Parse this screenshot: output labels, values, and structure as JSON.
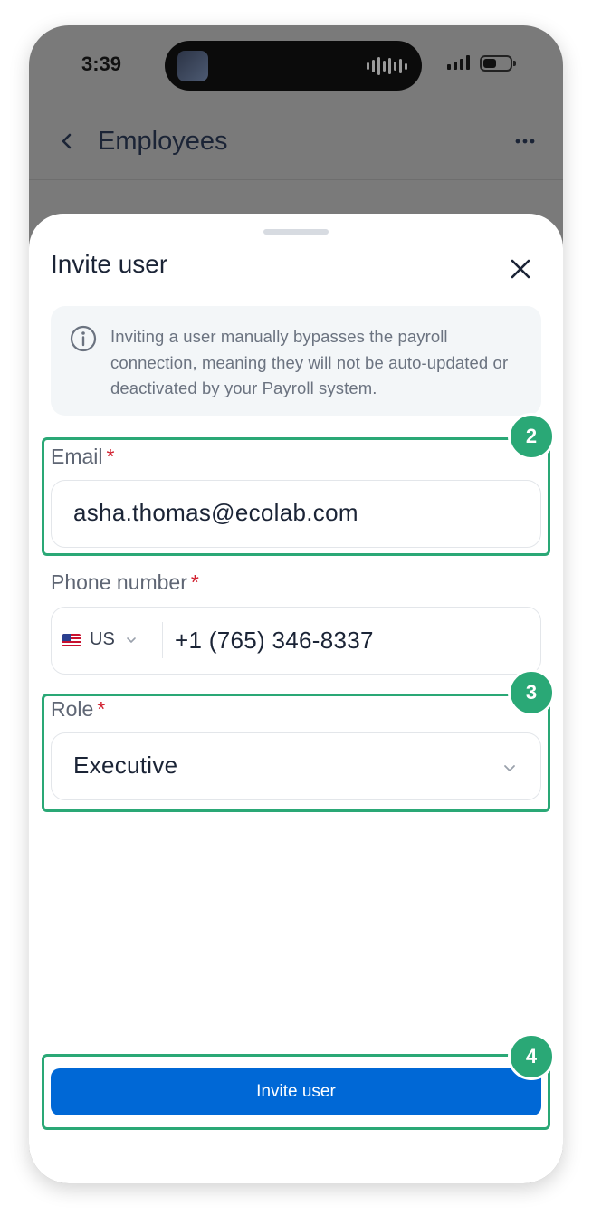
{
  "status_bar": {
    "time": "3:39"
  },
  "background_screen": {
    "title": "Employees"
  },
  "sheet": {
    "title": "Invite user",
    "notice": "Inviting a user manually bypasses the payroll connection, meaning they will not be auto-updated or deactivated by your Payroll system.",
    "email": {
      "label": "Email",
      "required_mark": "*",
      "value": "asha.thomas@ecolab.com"
    },
    "phone": {
      "label": "Phone number",
      "required_mark": "*",
      "country": "US",
      "value": "+1 (765) 346-8337"
    },
    "role": {
      "label": "Role",
      "required_mark": "*",
      "value": "Executive"
    },
    "submit_label": "Invite user"
  },
  "annotations": [
    {
      "number": "2",
      "target": "Email"
    },
    {
      "number": "3",
      "target": "Role"
    },
    {
      "number": "4",
      "target": "Invite user"
    }
  ],
  "colors": {
    "primary_button": "#0068d6",
    "annotation": "#2aa876",
    "required": "#d11f2e"
  },
  "icons": [
    "back-icon",
    "more-icon",
    "close-icon",
    "info-icon",
    "us-flag-icon",
    "chevron-down-icon"
  ]
}
